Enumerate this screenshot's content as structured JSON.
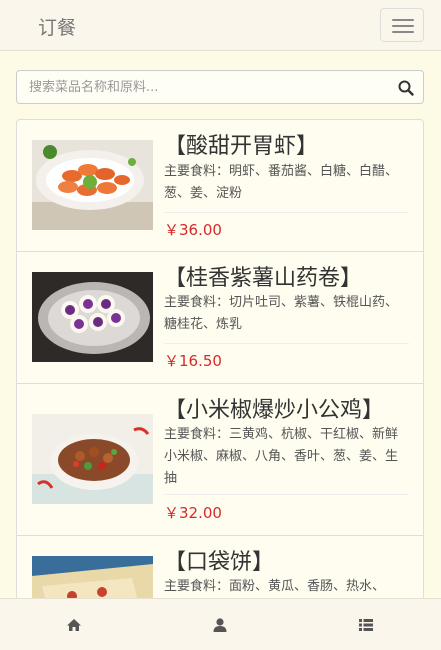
{
  "navbar": {
    "brand": "订餐",
    "menu_icon": "hamburger-icon"
  },
  "search": {
    "placeholder": "搜索菜品名称和原料...",
    "icon": "search-icon"
  },
  "dishes": [
    {
      "name": "【酸甜开胃虾】",
      "ingredients": "主要食料：明虾、番茄酱、白糖、白醋、葱、姜、淀粉",
      "price": "￥36.00"
    },
    {
      "name": "【桂香紫薯山药卷】",
      "ingredients": "主要食料：切片吐司、紫薯、铁棍山药、糖桂花、炼乳",
      "price": "￥16.50"
    },
    {
      "name": "【小米椒爆炒小公鸡】",
      "ingredients": "主要食料：三黄鸡、杭椒、干红椒、新鲜小米椒、麻椒、八角、香叶、葱、姜、生抽",
      "price": "￥32.00"
    },
    {
      "name": "【口袋饼】",
      "ingredients": "主要食料：面粉、黄瓜、香肠、热水、",
      "price": ""
    }
  ],
  "tabbar": {
    "items": [
      "home-icon",
      "user-icon",
      "list-icon"
    ]
  },
  "colors": {
    "price": "#d62a2a",
    "background": "#fdfae6",
    "navbar": "#fbf6ec"
  }
}
